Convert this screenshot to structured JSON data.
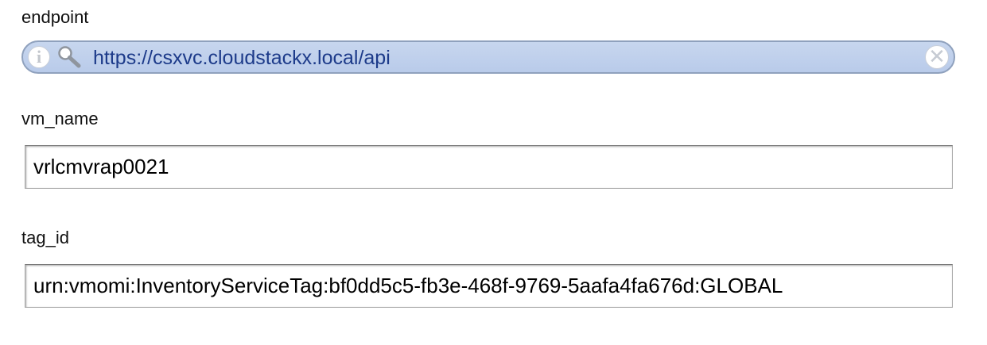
{
  "endpoint": {
    "label": "endpoint",
    "value": "https://csxvc.cloudstackx.local/api",
    "info_icon": "info-icon",
    "search_icon": "search-icon",
    "clear_icon": "clear-icon",
    "colors": {
      "pill_bg": "#bfd0ec",
      "text": "#1d3b8a"
    }
  },
  "vm_name": {
    "label": "vm_name",
    "value": "vrlcmvrap0021"
  },
  "tag_id": {
    "label": "tag_id",
    "value": "urn:vmomi:InventoryServiceTag:bf0dd5c5-fb3e-468f-9769-5aafa4fa676d:GLOBAL"
  }
}
